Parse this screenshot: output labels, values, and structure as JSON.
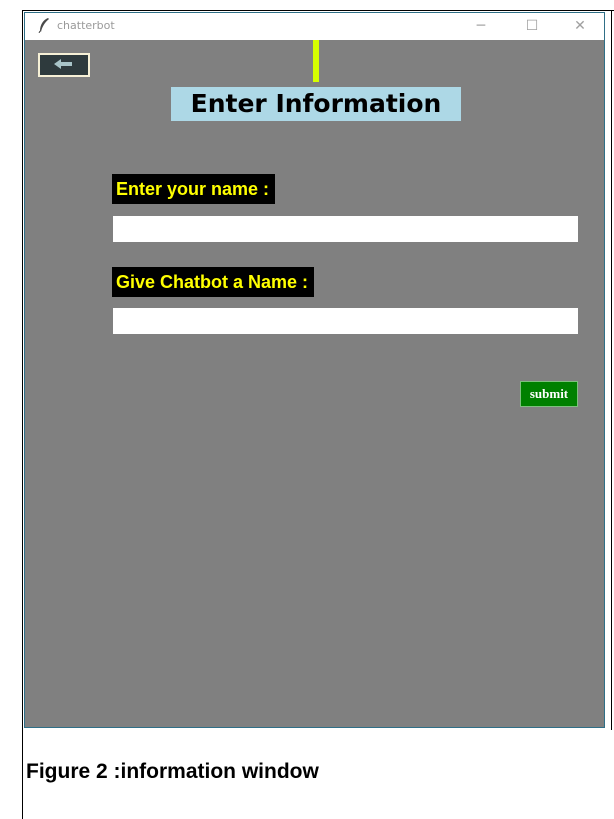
{
  "window": {
    "title": "chatterbot",
    "controls": {
      "minimize": "─",
      "maximize": "☐",
      "close": "✕"
    }
  },
  "content": {
    "back_button_icon": "left-arrow-icon",
    "heading": "Enter Information",
    "fields": [
      {
        "label": "Enter your name :",
        "value": ""
      },
      {
        "label": "Give Chatbot a Name :",
        "value": ""
      }
    ],
    "submit_label": "submit"
  },
  "caption": "Figure 2 :information window",
  "colors": {
    "window_bg": "#808080",
    "heading_bg": "#add8e6",
    "label_bg": "#000000",
    "label_text": "#ffff00",
    "submit_bg": "#008000",
    "accent_bar": "#d6ff00"
  }
}
